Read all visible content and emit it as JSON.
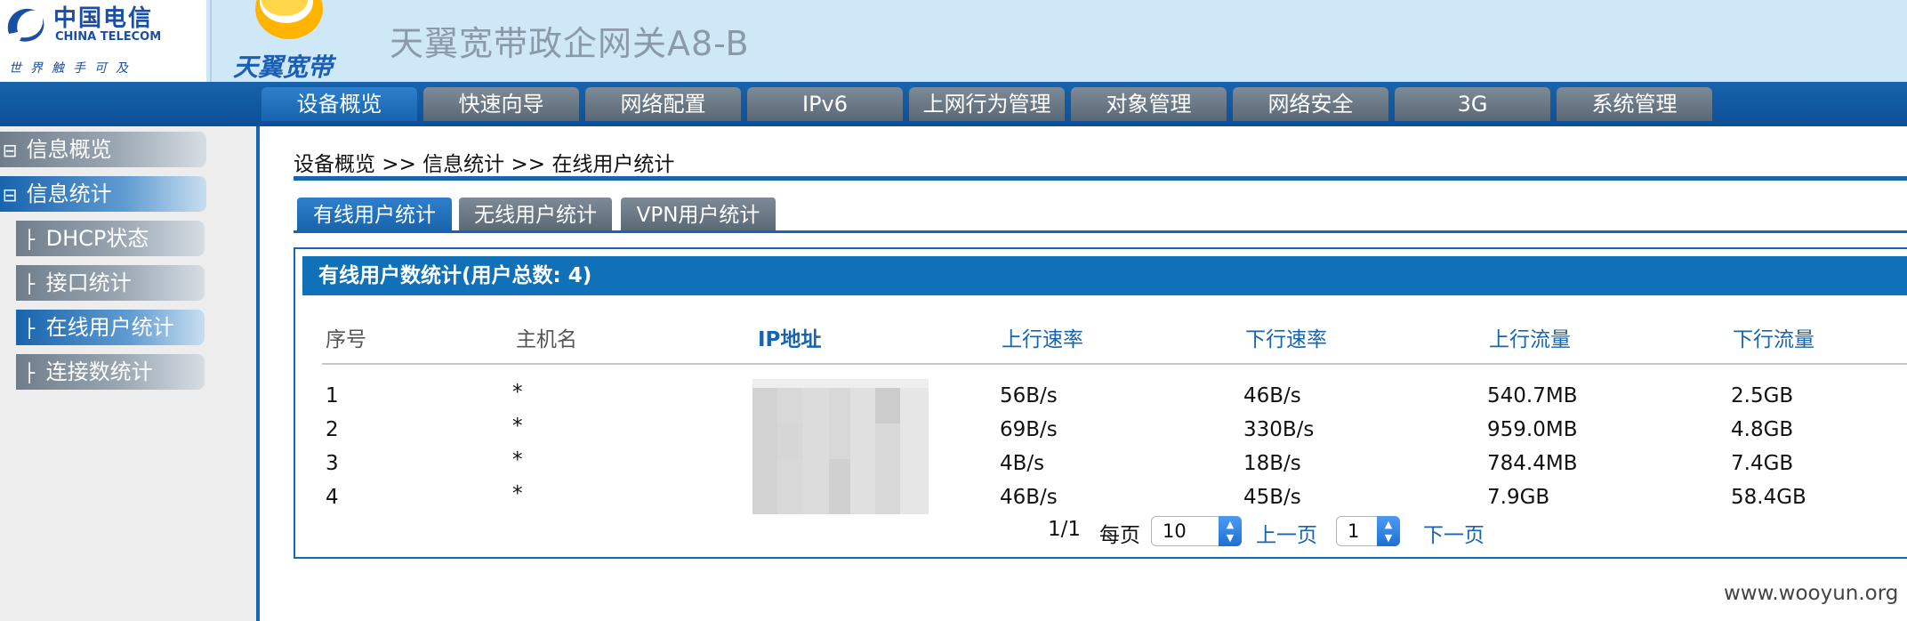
{
  "header": {
    "product_title": "天翼宽带政企网关A8-B",
    "logo_cn": "中国电信",
    "logo_en": "CHINA TELECOM",
    "logo_slogan": "世界触手可及",
    "brand_logo_text": "天翼宽带",
    "colors": {
      "header_bg": "#cfe8f7",
      "brand_blue": "#1864ad"
    }
  },
  "nav": {
    "tabs": [
      {
        "label": "设备概览",
        "active": true
      },
      {
        "label": "快速向导",
        "active": false
      },
      {
        "label": "网络配置",
        "active": false
      },
      {
        "label": "IPv6",
        "active": false
      },
      {
        "label": "上网行为管理",
        "active": false
      },
      {
        "label": "对象管理",
        "active": false
      },
      {
        "label": "网络安全",
        "active": false
      },
      {
        "label": "3G",
        "active": false
      },
      {
        "label": "系统管理",
        "active": false
      }
    ]
  },
  "sidebar": {
    "items": [
      {
        "prefix": "⊟",
        "label": "信息概览",
        "level": 0,
        "active": false
      },
      {
        "prefix": "⊟",
        "label": "信息统计",
        "level": 0,
        "active": true
      },
      {
        "prefix": "├",
        "label": "DHCP状态",
        "level": 1,
        "active": false
      },
      {
        "prefix": "├",
        "label": "接口统计",
        "level": 1,
        "active": false
      },
      {
        "prefix": "├",
        "label": "在线用户统计",
        "level": 1,
        "active": true
      },
      {
        "prefix": "├",
        "label": "连接数统计",
        "level": 1,
        "active": false
      }
    ]
  },
  "breadcrumb": "设备概览 >> 信息统计 >> 在线用户统计",
  "subtabs": [
    {
      "label": "有线用户统计",
      "active": true
    },
    {
      "label": "无线用户统计",
      "active": false
    },
    {
      "label": "VPN用户统计",
      "active": false
    }
  ],
  "panel": {
    "title": "有线用户数统计(用户总数: 4)",
    "columns": [
      "序号",
      "主机名",
      "IP地址",
      "上行速率",
      "下行速率",
      "上行流量",
      "下行流量"
    ],
    "rows": [
      {
        "index": "1",
        "host": "*",
        "up_rate": "56B/s",
        "down_rate": "46B/s",
        "up_traffic": "540.7MB",
        "down_traffic": "2.5GB"
      },
      {
        "index": "2",
        "host": "*",
        "up_rate": "69B/s",
        "down_rate": "330B/s",
        "up_traffic": "959.0MB",
        "down_traffic": "4.8GB"
      },
      {
        "index": "3",
        "host": "*",
        "up_rate": "4B/s",
        "down_rate": "18B/s",
        "up_traffic": "784.4MB",
        "down_traffic": "7.4GB"
      },
      {
        "index": "4",
        "host": "*",
        "up_rate": "46B/s",
        "down_rate": "45B/s",
        "up_traffic": "7.9GB",
        "down_traffic": "58.4GB"
      }
    ]
  },
  "pagination": {
    "page_info": "1/1",
    "per_page_label": "每页",
    "per_page_value": "10",
    "prev_label": "上一页",
    "page_value": "1",
    "next_label": "下一页"
  },
  "watermark": "www.wooyun.org"
}
